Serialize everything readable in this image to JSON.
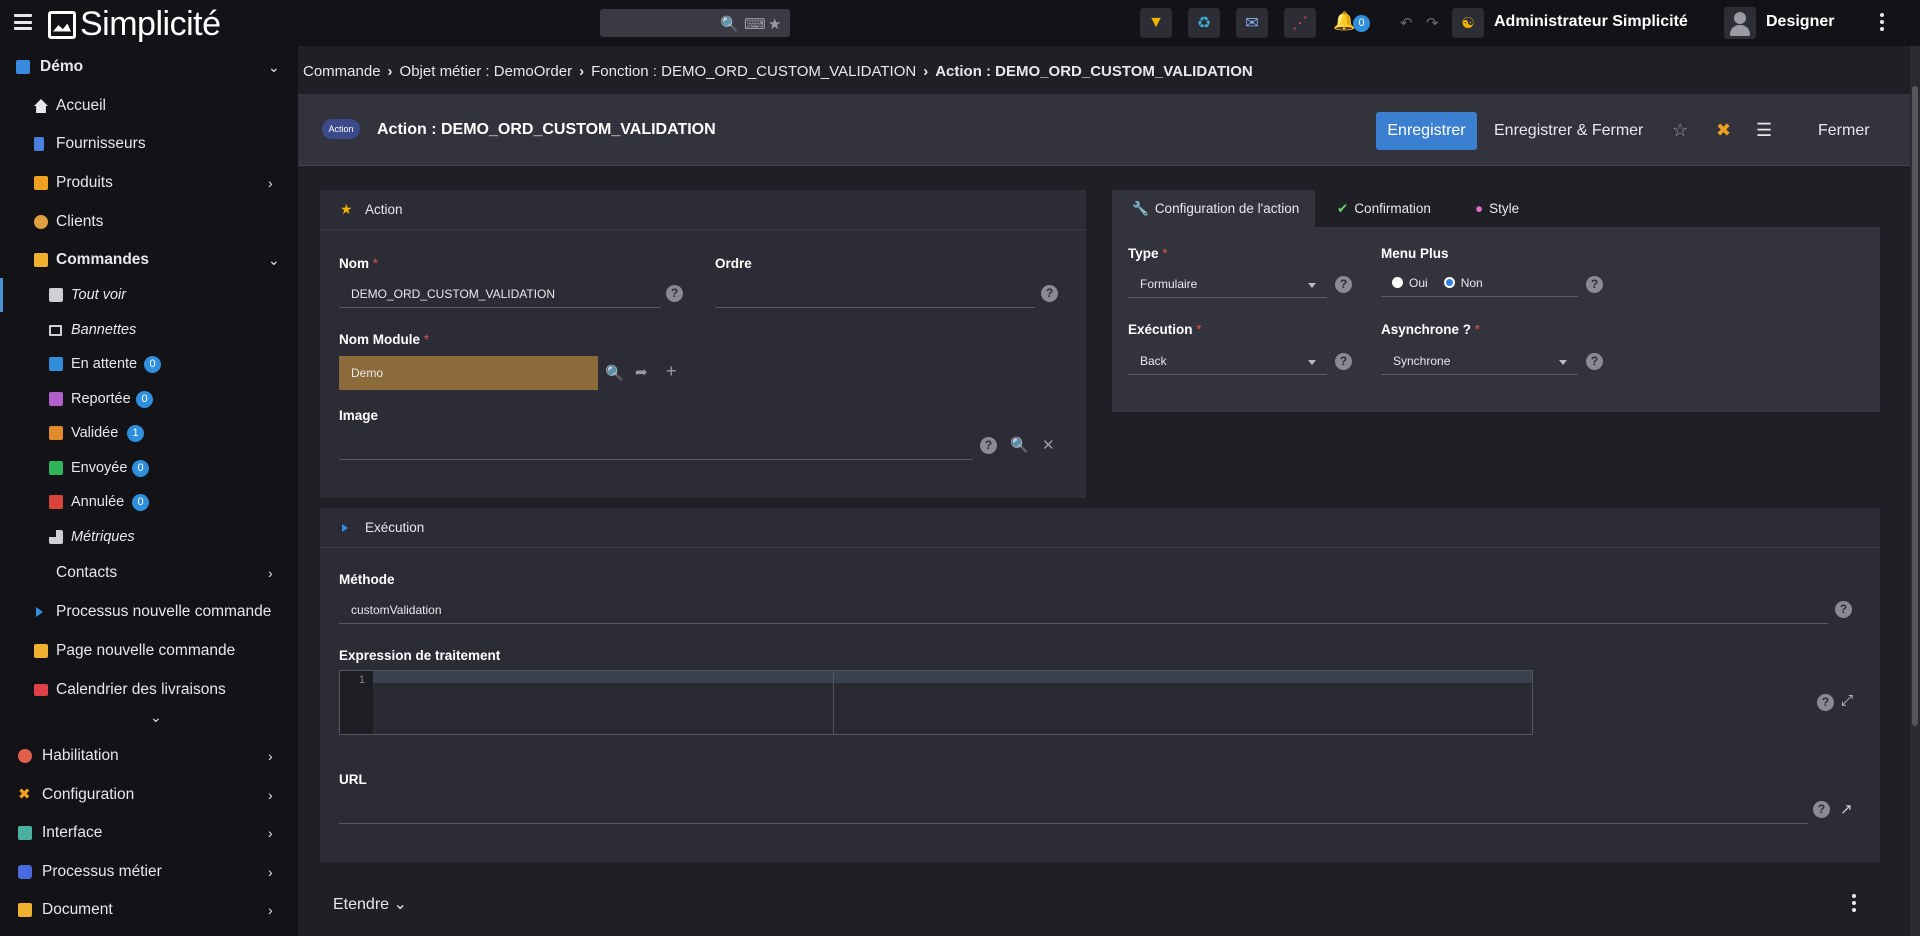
{
  "app": {
    "logo": "Simplicité",
    "user_name": "Administrateur Simplicité",
    "designer_label": "Designer",
    "notifications": "0"
  },
  "sidebar": {
    "scope": "Démo",
    "items": [
      {
        "label": "Accueil"
      },
      {
        "label": "Fournisseurs"
      },
      {
        "label": "Produits"
      },
      {
        "label": "Clients"
      },
      {
        "label": "Commandes"
      }
    ],
    "sub_items": [
      {
        "label": "Tout voir"
      },
      {
        "label": "Bannettes"
      },
      {
        "label": "En attente",
        "count": "0",
        "color": "#2f8fdd"
      },
      {
        "label": "Reportée",
        "count": "0",
        "color": "#b060c8"
      },
      {
        "label": "Validée",
        "count": "1",
        "color": "#e08a2a"
      },
      {
        "label": "Envoyée",
        "count": "0",
        "color": "#2fb45a"
      },
      {
        "label": "Annulée",
        "count": "0",
        "color": "#d9443a"
      },
      {
        "label": "Métriques"
      }
    ],
    "items2": [
      {
        "label": "Contacts"
      },
      {
        "label": "Processus nouvelle commande"
      },
      {
        "label": "Page nouvelle commande"
      },
      {
        "label": "Calendrier des livraisons"
      }
    ],
    "groups": [
      {
        "label": "Habilitation"
      },
      {
        "label": "Configuration"
      },
      {
        "label": "Interface"
      },
      {
        "label": "Processus métier"
      },
      {
        "label": "Document"
      }
    ]
  },
  "breadcrumb": {
    "items": [
      "Commande",
      "Objet métier : DemoOrder",
      "Fonction : DEMO_ORD_CUSTOM_VALIDATION"
    ],
    "current": "Action : DEMO_ORD_CUSTOM_VALIDATION"
  },
  "header": {
    "badge": "Action",
    "title": "Action : DEMO_ORD_CUSTOM_VALIDATION",
    "save_label": "Enregistrer",
    "save_close_label": "Enregistrer & Fermer",
    "close_label": "Fermer"
  },
  "action_panel": {
    "title": "Action",
    "nom_label": "Nom",
    "nom_value": "DEMO_ORD_CUSTOM_VALIDATION",
    "ordre_label": "Ordre",
    "ordre_value": "",
    "module_label": "Nom Module",
    "module_value": "Demo",
    "image_label": "Image",
    "image_value": ""
  },
  "config_panel": {
    "tabs": [
      "Configuration de l'action",
      "Confirmation",
      "Style"
    ],
    "type_label": "Type",
    "type_value": "Formulaire",
    "menu_plus_label": "Menu Plus",
    "oui": "Oui",
    "non": "Non",
    "execution_label": "Exécution",
    "execution_value": "Back",
    "async_label": "Asynchrone ?",
    "async_value": "Synchrone"
  },
  "execution_panel": {
    "title": "Exécution",
    "methode_label": "Méthode",
    "methode_value": "customValidation",
    "expr_label": "Expression de traitement",
    "line_number": "1",
    "url_label": "URL",
    "url_value": ""
  },
  "footer": {
    "expand_label": "Etendre"
  }
}
